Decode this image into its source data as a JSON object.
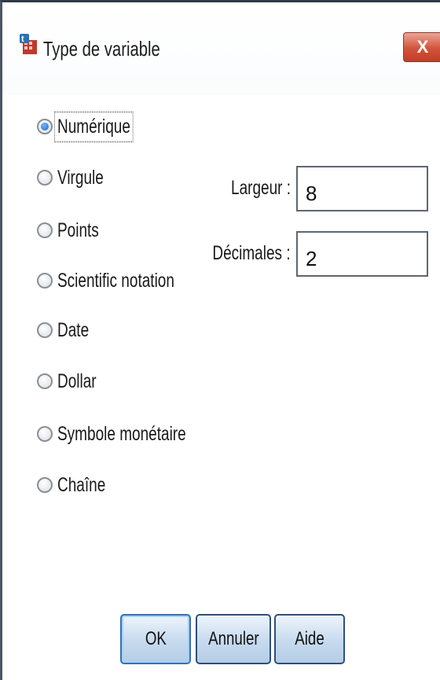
{
  "window": {
    "title": "Type de variable",
    "close_label": "X"
  },
  "types": [
    {
      "label": "Numérique",
      "checked": true
    },
    {
      "label": "Virgule",
      "checked": false
    },
    {
      "label": "Points",
      "checked": false
    },
    {
      "label": "Scientific notation",
      "checked": false
    },
    {
      "label": "Date",
      "checked": false
    },
    {
      "label": "Dollar",
      "checked": false
    },
    {
      "label": "Symbole monétaire",
      "checked": false
    },
    {
      "label": "Chaîne",
      "checked": false
    }
  ],
  "fields": {
    "width_label": "Largeur :",
    "width_value": "8",
    "decimals_label": "Décimales :",
    "decimals_value": "2"
  },
  "buttons": {
    "ok": "OK",
    "cancel": "Annuler",
    "help": "Aide"
  }
}
